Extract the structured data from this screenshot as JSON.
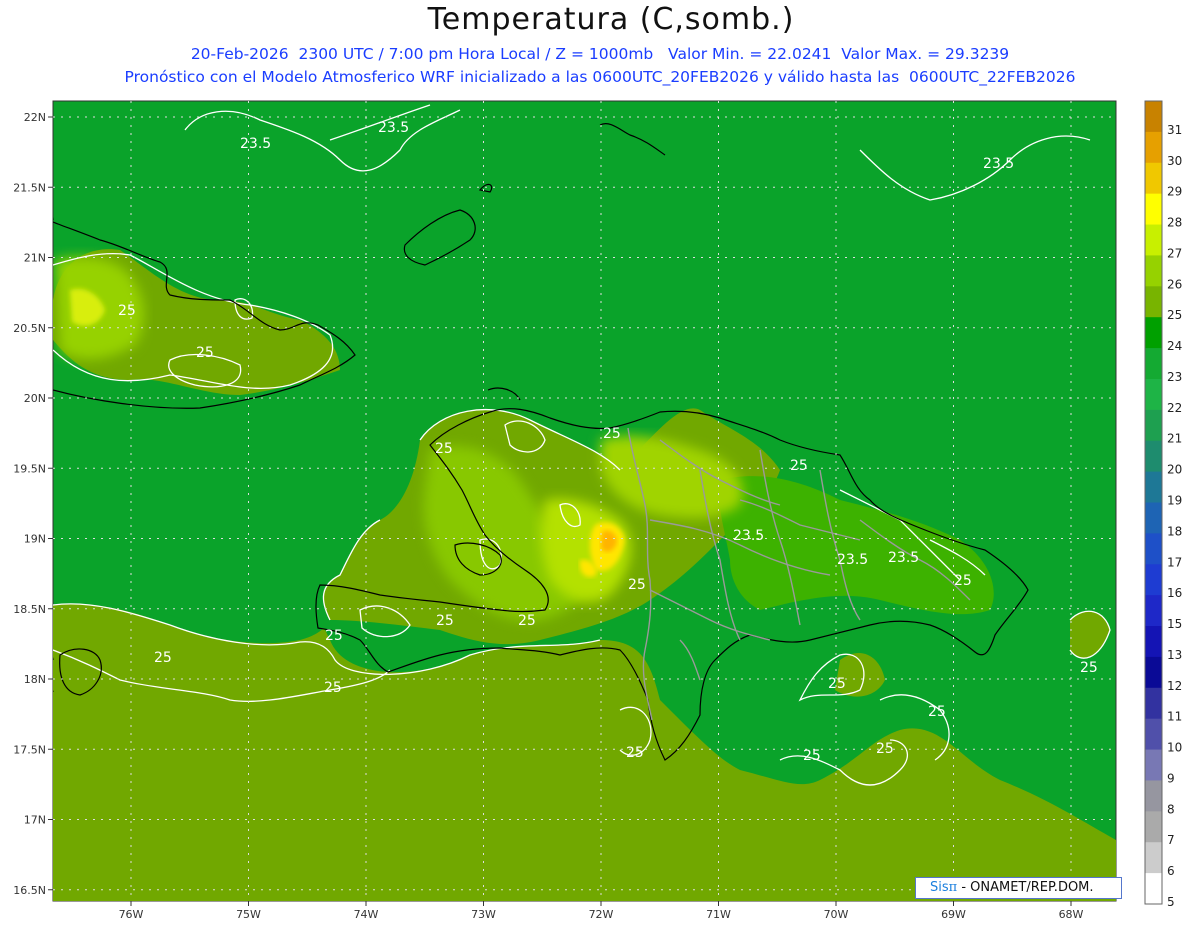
{
  "header": {
    "title": "Temperatura (C,somb.)",
    "line1": "20-Feb-2026  2300 UTC / 7:00 pm Hora Local / Z = 1000mb   Valor Min. = 22.0241  Valor Max. = 29.3239",
    "line2": "Pronóstico con el Modelo Atmosferico WRF inicializado a las 0600UTC_20FEB2026 y válido hasta las  0600UTC_22FEB2026"
  },
  "axes": {
    "lat_labels": [
      "22N",
      "21.5N",
      "21N",
      "20.5N",
      "20N",
      "19.5N",
      "19N",
      "18.5N",
      "18N",
      "17.5N",
      "17N",
      "16.5N"
    ],
    "lon_labels": [
      "76W",
      "75W",
      "74W",
      "73W",
      "72W",
      "71W",
      "70W",
      "69W",
      "68W"
    ],
    "lat_values": [
      22,
      21.5,
      21,
      20.5,
      20,
      19.5,
      19,
      18.5,
      18,
      17.5,
      17,
      16.5
    ],
    "lon_values": [
      -76,
      -75,
      -74,
      -73,
      -72,
      -71,
      -70,
      -69,
      -68
    ]
  },
  "colorbar": {
    "values": [
      "31",
      "30",
      "29",
      "28",
      "27",
      "26",
      "25",
      "24",
      "23",
      "22",
      "21",
      "20",
      "19",
      "18",
      "17",
      "16",
      "15",
      "13",
      "12",
      "11",
      "10",
      "9",
      "8",
      "7",
      "6",
      "5"
    ],
    "colors": [
      "#c88200",
      "#e6a000",
      "#f0c800",
      "#ffff00",
      "#c8f000",
      "#96d200",
      "#78b400",
      "#00a000",
      "#14aa32",
      "#1eb446",
      "#1ea050",
      "#1e8c6e",
      "#1e7896",
      "#1e64b4",
      "#1e50c8",
      "#1e3cd2",
      "#1e28c8",
      "#1414b4",
      "#0a0a96",
      "#3232a0",
      "#5050aa",
      "#7878b4",
      "#9696a0",
      "#aaaaaa",
      "#cccccc",
      "#ffffff"
    ]
  },
  "contour_labels": [
    "23.5",
    "23.5",
    "23.5",
    "25",
    "25",
    "25",
    "25",
    "25",
    "23.5",
    "25",
    "23.5",
    "23.5",
    "25",
    "25",
    "25",
    "25",
    "25",
    "25",
    "25",
    "25",
    "25",
    "25",
    "25"
  ],
  "legend": {
    "min": "22.0241",
    "max": "29.3239",
    "unit": "C"
  },
  "credit": {
    "brand": "Sis",
    "pi": "π",
    "text": " - ONAMET/REP.DOM."
  }
}
